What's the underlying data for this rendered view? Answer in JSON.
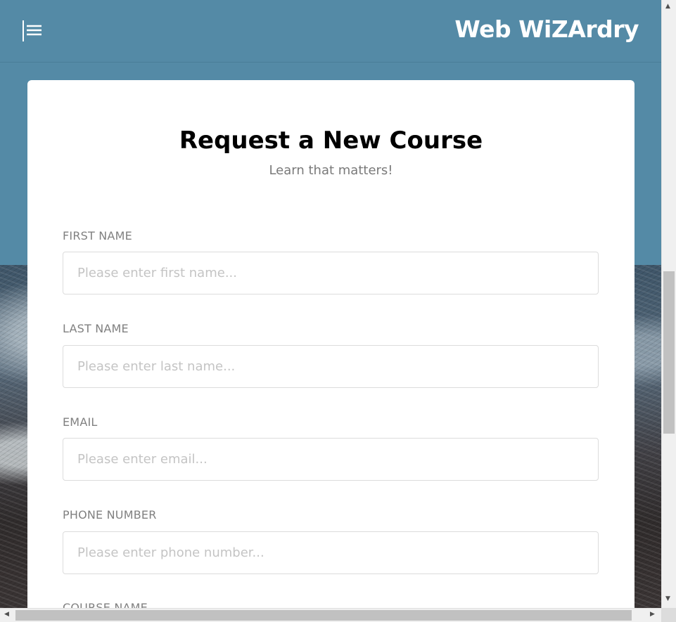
{
  "header": {
    "brand": "Web WiZArdry",
    "menu_icon": "menu-lines-icon"
  },
  "form": {
    "title": "Request a New Course",
    "subtitle": "Learn that matters!",
    "fields": [
      {
        "label": "FIRST NAME",
        "placeholder": "Please enter first name...",
        "value": ""
      },
      {
        "label": "LAST NAME",
        "placeholder": "Please enter last name...",
        "value": ""
      },
      {
        "label": "EMAIL",
        "placeholder": "Please enter email...",
        "value": ""
      },
      {
        "label": "PHONE NUMBER",
        "placeholder": "Please enter phone number...",
        "value": ""
      },
      {
        "label": "COURSE NAME"
      }
    ]
  },
  "colors": {
    "header_bg": "#548aa6",
    "brand_text": "#ffffff",
    "label_text": "#808080",
    "placeholder_text": "#c4c4c4"
  }
}
